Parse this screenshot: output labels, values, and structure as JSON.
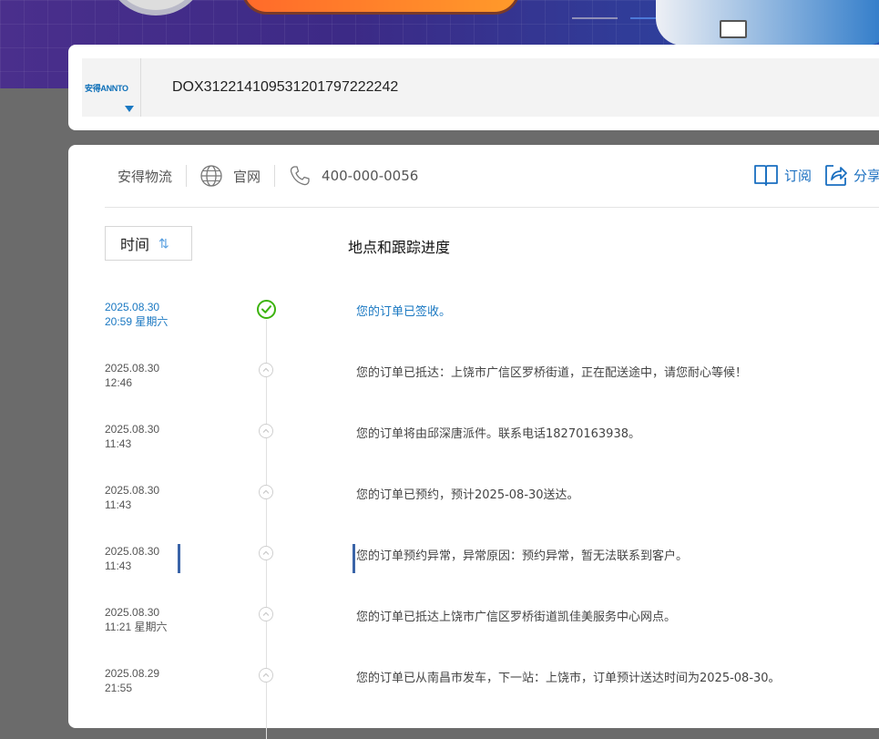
{
  "search": {
    "logo_text": "安得ANNTO",
    "tracking_number": "DOX312214109531201797222242"
  },
  "info_bar": {
    "company": "安得物流",
    "website_label": "官网",
    "phone": "400-000-0056",
    "subscribe_label": "订阅",
    "share_label": "分享"
  },
  "table": {
    "sort_label": "时间",
    "sort_icon": "sort-arrows-icon",
    "column_header": "地点和跟踪进度"
  },
  "colors": {
    "accent": "#1a78c2",
    "done_green": "#3cb30e",
    "marker": "#3a64a8"
  },
  "events": [
    {
      "date": "2025.08.30",
      "time": "20:59 星期六",
      "message": "您的订单已签收。",
      "status": "delivered"
    },
    {
      "date": "2025.08.30",
      "time": "12:46",
      "message": "您的订单已抵达：上饶市广信区罗桥街道，正在配送途中，请您耐心等候！",
      "status": "transit"
    },
    {
      "date": "2025.08.30",
      "time": "11:43",
      "message": "您的订单将由邱深唐派件。联系电话18270163938。",
      "status": "transit"
    },
    {
      "date": "2025.08.30",
      "time": "11:43",
      "message": "您的订单已预约，预计2025-08-30送达。",
      "status": "transit"
    },
    {
      "date": "2025.08.30",
      "time": "11:43",
      "message": "您的订单预约异常，异常原因：预约异常，暂无法联系到客户。",
      "status": "exception"
    },
    {
      "date": "2025.08.30",
      "time": "11:21 星期六",
      "message": "您的订单已抵达上饶市广信区罗桥街道凯佳美服务中心网点。",
      "status": "transit"
    },
    {
      "date": "2025.08.29",
      "time": "21:55",
      "message": "您的订单已从南昌市发车，下一站：上饶市，订单预计送达时间为2025-08-30。",
      "status": "transit"
    }
  ]
}
